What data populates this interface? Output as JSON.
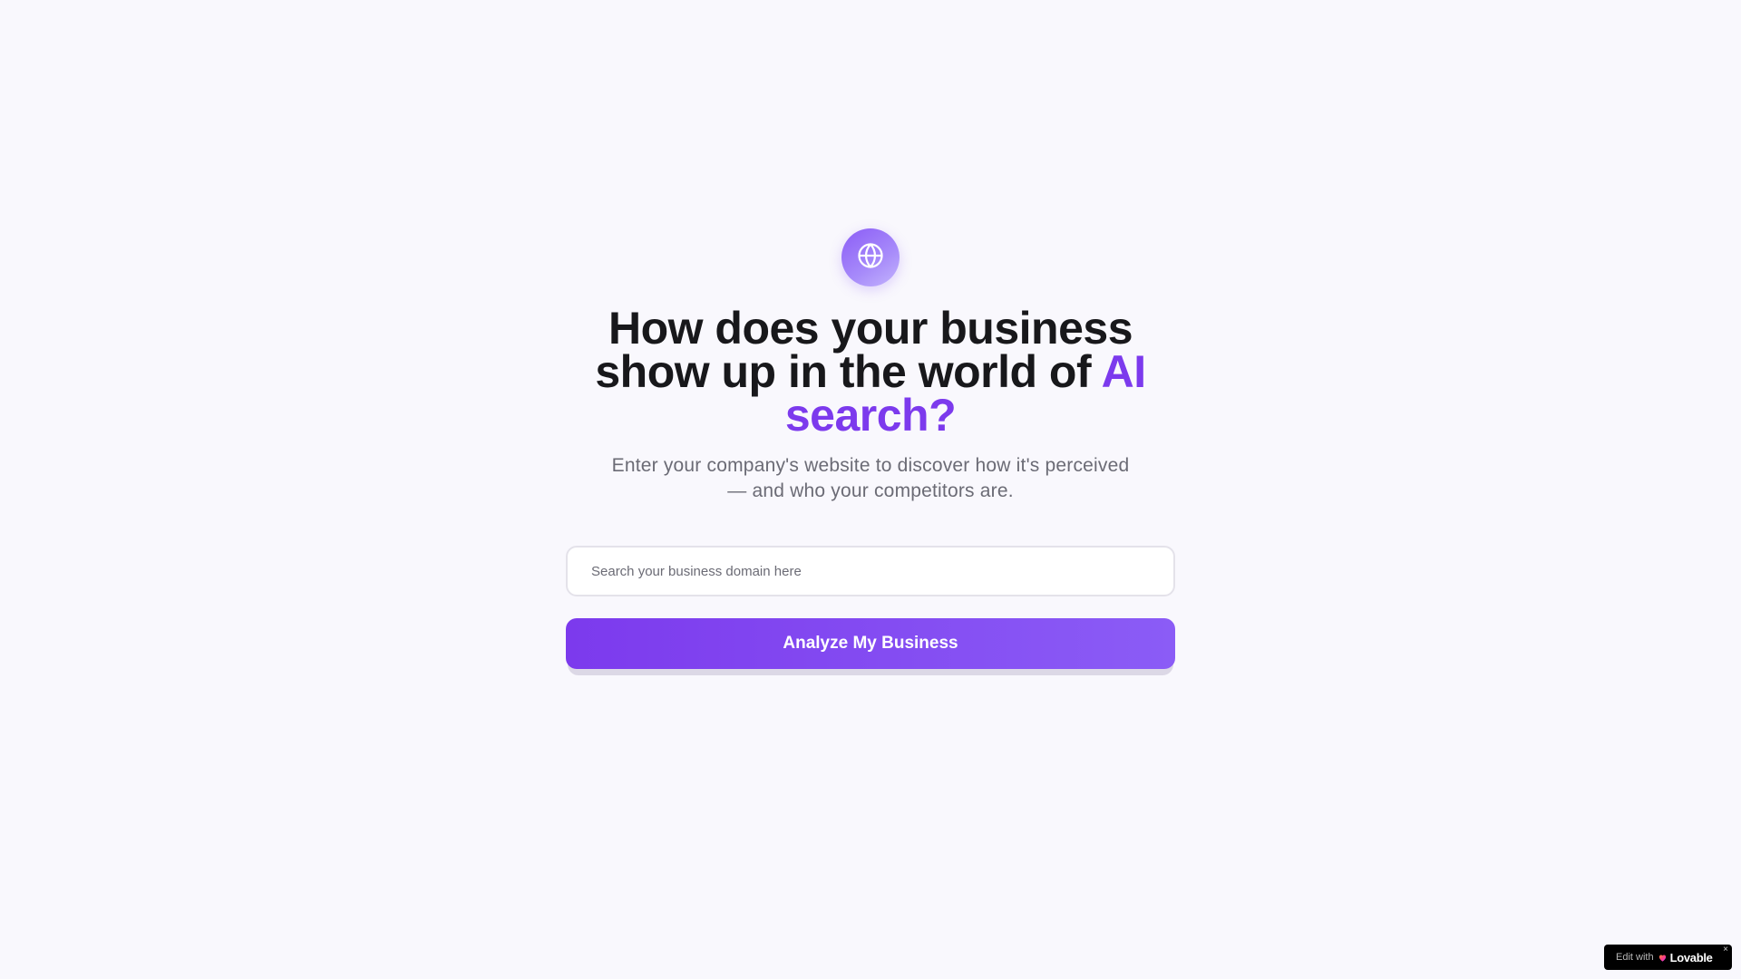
{
  "hero": {
    "icon": "globe-icon",
    "headline_main": "How does your business show up in the world of ",
    "headline_accent": "AI search?",
    "subtitle": "Enter your company's website to discover how it's perceived — and who your competitors are."
  },
  "search": {
    "placeholder": "Search your business domain here",
    "value": ""
  },
  "cta": {
    "label": "Analyze My Business"
  },
  "badge": {
    "prefix": "Edit with",
    "brand": "Lovable",
    "close": "×",
    "icon": "heart-icon"
  },
  "colors": {
    "background": "#f9f8fd",
    "accent": "#7c3aed",
    "heading": "#18181b",
    "muted": "#6b6b75"
  }
}
